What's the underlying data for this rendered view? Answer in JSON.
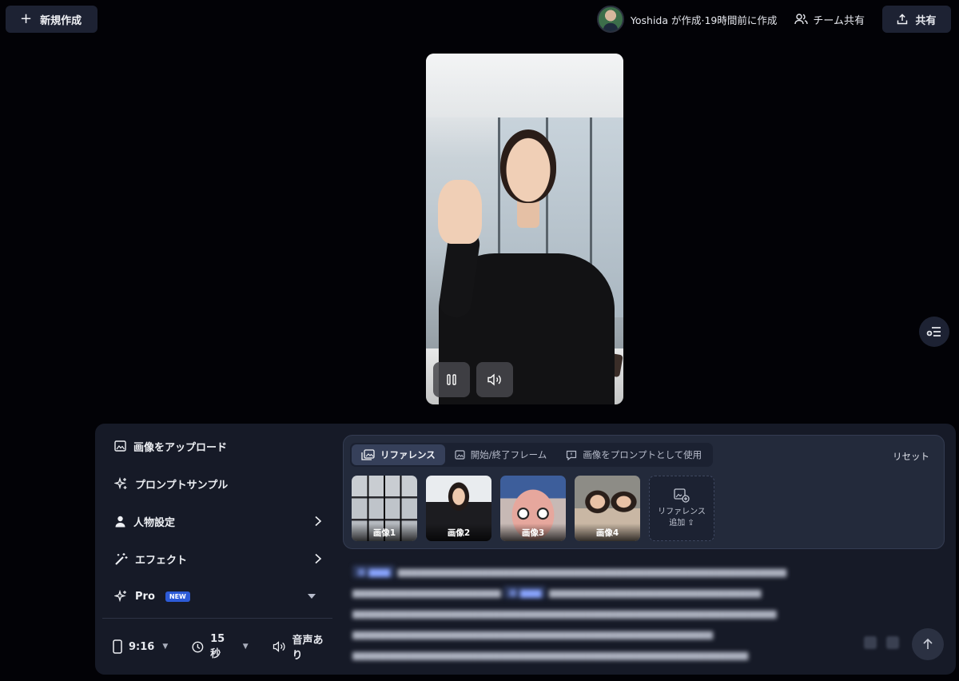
{
  "header": {
    "new_button": "新規作成",
    "creator_text": "Yoshida が作成·19時間前に作成",
    "team_share": "チーム共有",
    "share_button": "共有"
  },
  "video": {
    "controls": [
      "pause",
      "volume"
    ]
  },
  "sidebar": {
    "items": [
      {
        "label": "画像をアップロード",
        "icon": "image-icon"
      },
      {
        "label": "プロンプトサンプル",
        "icon": "sparkle-icon"
      },
      {
        "label": "人物設定",
        "icon": "person-icon",
        "has_arrow": true
      },
      {
        "label": "エフェクト",
        "icon": "magic-wand-icon",
        "has_arrow": true
      }
    ],
    "model": {
      "label": "Pro",
      "badge": "NEW"
    },
    "settings": {
      "aspect": "9:16",
      "duration": "15秒",
      "audio": "音声あり"
    }
  },
  "reference": {
    "tabs": [
      "リファレンス",
      "開始/終了フレーム",
      "画像をプロンプトとして使用"
    ],
    "active_tab": 0,
    "reset": "リセット",
    "images": [
      "画像1",
      "画像2",
      "画像3",
      "画像4"
    ],
    "add_label_1": "リファレンス",
    "add_label_2": "追加"
  },
  "colors": {
    "background": "#020206",
    "panel": "#161a27",
    "accent_badge": "#2d5bd7"
  }
}
